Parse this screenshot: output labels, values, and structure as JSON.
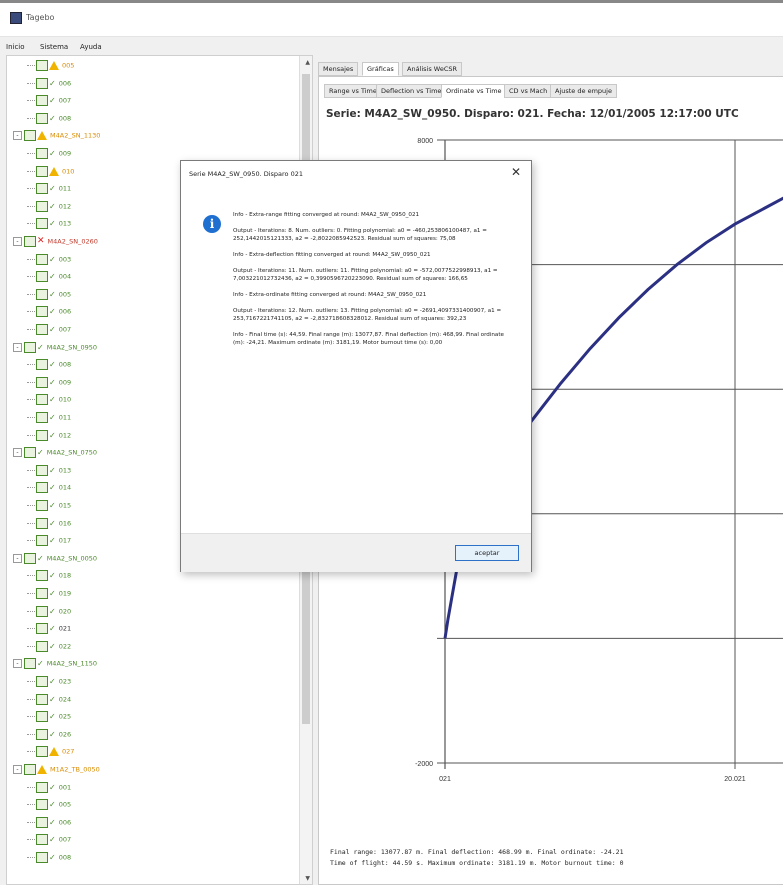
{
  "window": {
    "title": "Tagebo"
  },
  "menu": [
    "Inicio",
    "Sistema",
    "Ayuda"
  ],
  "tree": [
    {
      "indent": 2,
      "label": "005",
      "status": "warn",
      "color": "#d98b00"
    },
    {
      "indent": 2,
      "label": "006",
      "status": "ok",
      "color": "#4a8a2a"
    },
    {
      "indent": 2,
      "label": "007",
      "status": "ok",
      "color": "#4a8a2a"
    },
    {
      "indent": 2,
      "label": "008",
      "status": "ok",
      "color": "#4a8a2a"
    },
    {
      "indent": 1,
      "label": "M4A2_SN_1130",
      "status": "warn",
      "color": "#d98b00",
      "expander": "-"
    },
    {
      "indent": 2,
      "label": "009",
      "status": "ok",
      "color": "#4a8a2a"
    },
    {
      "indent": 2,
      "label": "010",
      "status": "warn",
      "color": "#d98b00"
    },
    {
      "indent": 2,
      "label": "011",
      "status": "ok",
      "color": "#4a8a2a"
    },
    {
      "indent": 2,
      "label": "012",
      "status": "ok",
      "color": "#4a8a2a"
    },
    {
      "indent": 2,
      "label": "013",
      "status": "ok",
      "color": "#4a8a2a"
    },
    {
      "indent": 1,
      "label": "M4A2_SN_0260",
      "status": "error",
      "color": "#c0392b",
      "expander": "-"
    },
    {
      "indent": 2,
      "label": "003",
      "status": "ok",
      "color": "#4a8a2a"
    },
    {
      "indent": 2,
      "label": "004",
      "status": "ok",
      "color": "#4a8a2a"
    },
    {
      "indent": 2,
      "label": "005",
      "status": "ok",
      "color": "#4a8a2a"
    },
    {
      "indent": 2,
      "label": "006",
      "status": "ok",
      "color": "#4a8a2a"
    },
    {
      "indent": 2,
      "label": "007",
      "status": "ok",
      "color": "#4a8a2a"
    },
    {
      "indent": 1,
      "label": "M4A2_SN_0950",
      "status": "ok",
      "color": "#4a8a2a",
      "expander": "-"
    },
    {
      "indent": 2,
      "label": "008",
      "status": "ok",
      "color": "#4a8a2a"
    },
    {
      "indent": 2,
      "label": "009",
      "status": "ok",
      "color": "#4a8a2a"
    },
    {
      "indent": 2,
      "label": "010",
      "status": "ok",
      "color": "#4a8a2a"
    },
    {
      "indent": 2,
      "label": "011",
      "status": "ok",
      "color": "#4a8a2a"
    },
    {
      "indent": 2,
      "label": "012",
      "status": "ok",
      "color": "#4a8a2a"
    },
    {
      "indent": 1,
      "label": "M4A2_SN_0750",
      "status": "ok",
      "color": "#4a8a2a",
      "expander": "-"
    },
    {
      "indent": 2,
      "label": "013",
      "status": "ok",
      "color": "#4a8a2a"
    },
    {
      "indent": 2,
      "label": "014",
      "status": "ok",
      "color": "#4a8a2a"
    },
    {
      "indent": 2,
      "label": "015",
      "status": "ok",
      "color": "#4a8a2a"
    },
    {
      "indent": 2,
      "label": "016",
      "status": "ok",
      "color": "#4a8a2a"
    },
    {
      "indent": 2,
      "label": "017",
      "status": "ok",
      "color": "#4a8a2a"
    },
    {
      "indent": 1,
      "label": "M4A2_SN_0050",
      "status": "ok",
      "color": "#4a8a2a",
      "expander": "-"
    },
    {
      "indent": 2,
      "label": "018",
      "status": "ok",
      "color": "#4a8a2a"
    },
    {
      "indent": 2,
      "label": "019",
      "status": "ok",
      "color": "#4a8a2a"
    },
    {
      "indent": 2,
      "label": "020",
      "status": "ok",
      "color": "#4a8a2a"
    },
    {
      "indent": 2,
      "label": "021",
      "status": "ok",
      "color": "#333333"
    },
    {
      "indent": 2,
      "label": "022",
      "status": "ok",
      "color": "#4a8a2a"
    },
    {
      "indent": 1,
      "label": "M4A2_SN_1150",
      "status": "ok",
      "color": "#4a8a2a",
      "expander": "-"
    },
    {
      "indent": 2,
      "label": "023",
      "status": "ok",
      "color": "#4a8a2a"
    },
    {
      "indent": 2,
      "label": "024",
      "status": "ok",
      "color": "#4a8a2a"
    },
    {
      "indent": 2,
      "label": "025",
      "status": "ok",
      "color": "#4a8a2a"
    },
    {
      "indent": 2,
      "label": "026",
      "status": "ok",
      "color": "#4a8a2a"
    },
    {
      "indent": 2,
      "label": "027",
      "status": "warn",
      "color": "#d98b00"
    },
    {
      "indent": 1,
      "label": "M1A2_TB_0050",
      "status": "warn",
      "color": "#d98b00",
      "expander": "-"
    },
    {
      "indent": 2,
      "label": "001",
      "status": "ok",
      "color": "#4a8a2a"
    },
    {
      "indent": 2,
      "label": "005",
      "status": "ok",
      "color": "#4a8a2a"
    },
    {
      "indent": 2,
      "label": "006",
      "status": "ok",
      "color": "#4a8a2a"
    },
    {
      "indent": 2,
      "label": "007",
      "status": "ok",
      "color": "#4a8a2a"
    },
    {
      "indent": 2,
      "label": "008",
      "status": "ok",
      "color": "#4a8a2a"
    }
  ],
  "tabs_top": [
    "Mensajes",
    "Gráficas",
    "Análisis WeCSR"
  ],
  "tabs_sub": [
    "Range vs Time",
    "Deflection vs Time",
    "Ordinate vs Time",
    "CD vs Mach",
    "Ajuste de empuje"
  ],
  "chart_title": "Serie: M4A2_SW_0950. Disparo: 021. Fecha: 12/01/2005 12:17:00 UTC",
  "chart_data": {
    "type": "line",
    "y_ticks": [
      "8000",
      "-2000"
    ],
    "x_ticks": [
      "021",
      "20.021"
    ],
    "ylim": [
      -2000,
      8000
    ],
    "series": [
      {
        "x": [
          0.0,
          0.2,
          0.5,
          1.0,
          2.0,
          4.0,
          6.0,
          8.0,
          10.0,
          12.0,
          14.0,
          16.0,
          18.0,
          20.0,
          22.0,
          24.0
        ],
        "y": [
          0,
          300,
          700,
          1350,
          2000,
          2850,
          3500,
          4100,
          4650,
          5150,
          5600,
          6000,
          6350,
          6650,
          6900,
          7150
        ]
      }
    ],
    "colors": {
      "line": "#2b3083",
      "grid": "#555555"
    }
  },
  "footer": {
    "line1": "Final range: 13077.87 m. Final deflection: 468.99 m. Final ordinate: -24.21",
    "line2": "Time of flight: 44.59 s. Maximum ordinate: 3181.19 m. Motor burnout time: 0"
  },
  "dialog": {
    "title": "Serie M4A2_SW_0950. Disparo 021",
    "close": "✕",
    "info_icon": "i",
    "messages": [
      "Info - Extra-range fitting converged at round: M4A2_SW_0950_021",
      "Output - Iterations: 8. Num. outliers: 0. Fitting polynomial: a0 = -460,253806100487, a1 = 252,1442015121333, a2 = -2,8022085942523. Residual sum of squares: 75,08",
      "Info - Extra-deflection fitting converged at round: M4A2_SW_0950_021",
      "Output - Iterations: 11. Num. outliers: 11. Fitting polynomial: a0 = -572,0077522998913, a1 = 7,003221012732436, a2 = 0,3990596720223090. Residual sum of squares: 166,65",
      "Info - Extra-ordinate fitting converged at round: M4A2_SW_0950_021",
      "Output - Iterations: 12. Num. outliers: 13. Fitting polynomial: a0 = -2691,4097331400907, a1 = 253,7167221741105, a2 = -2,832718608328012. Residual sum of squares: 392,23",
      "Info - Final time (s): 44,59. Final range (m): 13077,87. Final deflection (m): 468,99. Final ordinate (m): -24,21. Maximum ordinate (m): 3181,19. Motor burnout time (s): 0,00"
    ],
    "ok_label": "aceptar"
  }
}
